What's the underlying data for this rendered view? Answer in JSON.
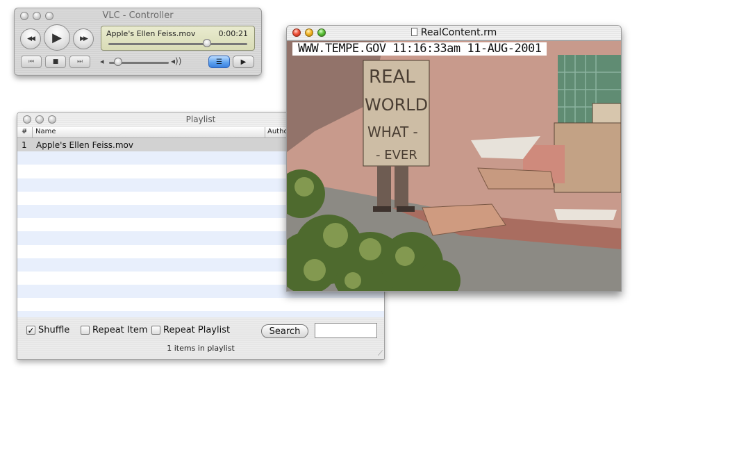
{
  "controller": {
    "title": "VLC - Controller",
    "now_playing": "Apple's Ellen Feiss.mov",
    "elapsed": "0:00:21",
    "position_fraction": 0.71,
    "volume_fraction": 0.15,
    "icons": {
      "rewind": "◀◀",
      "play": "▶",
      "fast_forward": "▶▶",
      "previous": "⏮",
      "stop": "■",
      "next": "⏭",
      "volume_low": "◂",
      "volume_high": "◂))",
      "playlist": "☰",
      "fullscreen": "▶"
    }
  },
  "playlist": {
    "title": "Playlist",
    "columns": {
      "num": "#",
      "name": "Name",
      "author": "Author"
    },
    "items": [
      {
        "num": "1",
        "name": "Apple's Ellen Feiss.mov"
      }
    ],
    "shuffle": {
      "label": "Shuffle",
      "checked": true,
      "mark": "✓"
    },
    "repeat_item": {
      "label": "Repeat Item",
      "checked": false
    },
    "repeat_playlist": {
      "label": "Repeat Playlist",
      "checked": false
    },
    "search_button": "Search",
    "search_value": "",
    "status": "1 items in playlist",
    "resize_grip": "⟋"
  },
  "video": {
    "title": "RealContent.rm",
    "overlay_text": "WWW.TEMPE.GOV 11:16:33am 11-AUG-2001",
    "sign_text": [
      "REAL",
      "WORLD",
      "WHAT -",
      "- EVER"
    ]
  }
}
